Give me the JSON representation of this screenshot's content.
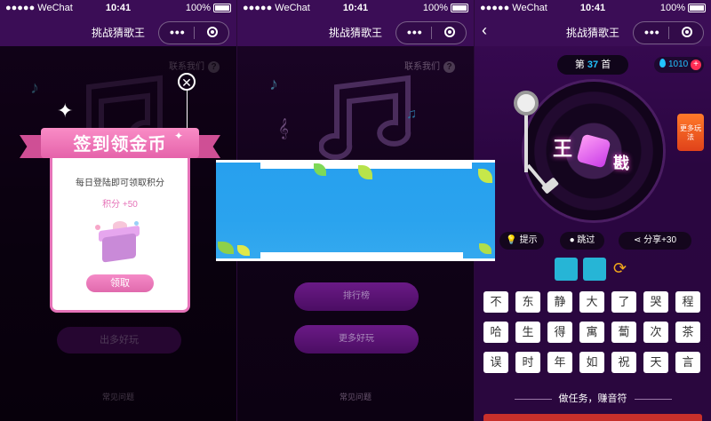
{
  "status": {
    "carrier": "●●●●● WeChat",
    "time": "10:41",
    "battery": "100%"
  },
  "navbar": {
    "title": "挑战猜歌王",
    "menu_dots": "•••"
  },
  "panel1": {
    "contact": "联系我们",
    "help": "?",
    "modal": {
      "title": "签到领金币",
      "desc": "每日登陆即可领取积分",
      "points": "积分 +50",
      "claim": "领取",
      "close": "✕"
    },
    "dim_button": "出多好玩",
    "faq": "常见问题"
  },
  "panel2": {
    "contact": "联系我们",
    "help": "?",
    "btn_rank": "排行榜",
    "btn_more": "更多好玩",
    "faq": "常见问题"
  },
  "panel3": {
    "back": "‹",
    "level_prefix": "第",
    "level_num": "37",
    "level_suffix": "首",
    "coins": "1010",
    "coins_plus": "+",
    "record_text_1": "王",
    "record_text_2": "戡",
    "more_games": "更多玩法",
    "hint": "提示",
    "skip": "跳过",
    "share": "分享+30",
    "keys": [
      [
        "不",
        "东",
        "静",
        "大",
        "了",
        "哭",
        "程"
      ],
      [
        "哈",
        "生",
        "得",
        "寓",
        "蔔",
        "次",
        "茶"
      ],
      [
        "误",
        "时",
        "年",
        "如",
        "祝",
        "天",
        "言"
      ]
    ],
    "task": "做任务，赚音符"
  }
}
